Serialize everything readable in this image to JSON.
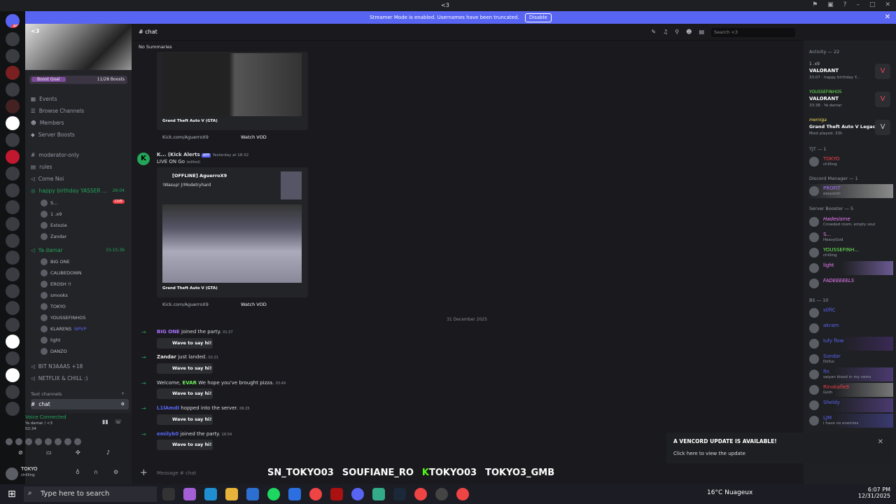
{
  "window": {
    "title": "<3"
  },
  "banner": {
    "text": "Streamer Mode is enabled. Usernames have been truncated.",
    "button": "Disable"
  },
  "server": {
    "name": "<3",
    "boost": {
      "label": "Boost Goal",
      "progress": "11/28 Boosts"
    },
    "nav": [
      "Events",
      "Browse Channels",
      "Members",
      "Server Boosts"
    ],
    "channels": [
      "moderator-only",
      "rules",
      "Come Noi",
      "happy birthday YASSER ..."
    ],
    "bday_time": "26:04",
    "stage_users": [
      "S...",
      "1 .x9",
      "Extozie",
      "Zandar"
    ],
    "live_badge": "LIVE",
    "voice_channel": {
      "name": "Ya damar",
      "time": "15:15:36"
    },
    "voice_users": [
      "BIG ONE",
      "CALIBEDOWN",
      "EROSH !!",
      "smooks",
      "TOKYO",
      "YOUSSEFINHO5",
      "KLARENS",
      "light",
      "DANZO"
    ],
    "npvp": "NPVP",
    "more_channels": [
      "BIT N3AAAS +18",
      "NETFLIX & CHILL :)"
    ],
    "text_channels_header": "Text channels",
    "active_channel": "chat",
    "voice_connected": {
      "status": "Voice Connected",
      "channel": "Ya damar / <3",
      "time": "02:34"
    },
    "user": {
      "name": "TOKYO",
      "status": "chilling"
    }
  },
  "chat": {
    "channel": "chat",
    "summaries": "No Summaries",
    "search_placeholder": "Search <3",
    "embed1": {
      "game": "Grand Theft Auto V (GTA)",
      "link": "Kick.com/AguerroX9",
      "vod": "Watch VOD"
    },
    "alert": {
      "author": "K... (Kick Alerts",
      "tag": "APP",
      "time": "Yesterday at 18:32",
      "text": "LIVE ON Go",
      "edited": "(edited)"
    },
    "embed2": {
      "title": "[OFFLINE] AguerroX9",
      "desc": "!Wasup! J!Modetryhard",
      "game": "Grand Theft Auto V (GTA)",
      "link": "Kick.com/AguerroX9",
      "vod": "Watch VOD"
    },
    "divider": "31 December 2025",
    "joins": [
      {
        "user": "BIG ONE",
        "text": "joined the party.",
        "time": "01:37",
        "wave": "Wave to say hi!",
        "color": "#a971ff"
      },
      {
        "user": "Zandar",
        "text": "just landed.",
        "time": "02:21",
        "wave": "Wave to say hi!",
        "color": "#e6e6e6"
      },
      {
        "user": "EVAR",
        "pre": "Welcome,",
        "text": "We hope you've brought pizza.",
        "time": "03:49",
        "wave": "Wave to say hi!",
        "color": "#6ef05a"
      },
      {
        "user": "L1lAmdI",
        "text": "hopped into the server.",
        "time": "06:25",
        "wave": "Wave to say hi!",
        "color": "#5865f2"
      },
      {
        "user": "emilyb0",
        "text": "joined the party.",
        "time": "16:54",
        "wave": "Wave to say hi!",
        "color": "#5865f2"
      }
    ],
    "composer_placeholder": "Message # chat",
    "socials": [
      "SN_TOKYO03",
      "SOUFIANE_RO",
      "TOKYO03",
      "TOKYO3_GMB"
    ]
  },
  "members": {
    "activity_header": "Activity — 22",
    "activities": [
      {
        "user": "1 .x9",
        "game": "VALORANT",
        "detail": "33:07 · happy birthday Y..."
      },
      {
        "user": "YOUSSEFINHO5",
        "game": "VALORANT",
        "detail": "33:38 · Ya damar"
      },
      {
        "user": "merniga",
        "game": "Grand Theft Auto V Legacy",
        "detail": "Most played: 33h"
      }
    ],
    "sections": [
      {
        "header": "TJT — 1",
        "members": [
          {
            "name": "TOKYO",
            "status": "chilling",
            "color": "#f23f43"
          }
        ]
      },
      {
        "header": "Discord Manager — 1",
        "members": [
          {
            "name": "PROFIT",
            "status": "easyanin",
            "color": "#a971ff"
          }
        ]
      },
      {
        "header": "Server Booster — 5",
        "members": [
          {
            "name": "Hadesisme",
            "status": "Crowded room, empty soul",
            "color": "#f47fff"
          },
          {
            "name": "S...",
            "status": "HeavyGod",
            "color": "#f47fff"
          },
          {
            "name": "YOUSSEFINH...",
            "status": "chilling",
            "color": "#6ef05a"
          },
          {
            "name": "light",
            "status": "",
            "color": "#f47fff"
          },
          {
            "name": "FADEEEEELS",
            "status": "",
            "color": "#f47fff"
          }
        ]
      },
      {
        "header": "BS — 10",
        "members": [
          {
            "name": "s0fiC",
            "status": "",
            "color": "#5865f2"
          },
          {
            "name": "akram",
            "status": "",
            "color": "#5865f2"
          },
          {
            "name": "lufy flow",
            "status": "",
            "color": "#5865f2"
          },
          {
            "name": "Sundar",
            "status": "Dofus",
            "color": "#5865f2"
          },
          {
            "name": "fin",
            "status": "saiyan blood in my veins",
            "color": "#5865f2"
          },
          {
            "name": "Rinokafle9",
            "status": "Goth",
            "color": "#f23f43"
          },
          {
            "name": "Sheldy",
            "status": "",
            "color": "#5865f2"
          },
          {
            "name": "LJM",
            "status": "i have no enemies",
            "color": "#5865f2"
          }
        ]
      }
    ]
  },
  "toast": {
    "title": "A VENCORD UPDATE IS AVAILABLE!",
    "text": "Click here to view the update"
  },
  "taskbar": {
    "search": "Type here to search",
    "weather": "16°C  Nuageux",
    "time": "6:07 PM",
    "date": "12/31/2025"
  }
}
